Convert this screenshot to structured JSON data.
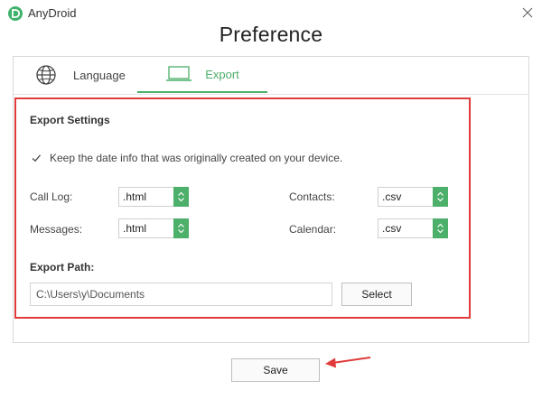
{
  "window": {
    "app_name": "AnyDroid",
    "page_title": "Preference",
    "close_icon": "close-icon"
  },
  "tabs": [
    {
      "label": "Language",
      "icon": "globe-icon",
      "active": false
    },
    {
      "label": "Export",
      "icon": "laptop-icon",
      "active": true
    }
  ],
  "export_settings": {
    "section_title": "Export Settings",
    "keep_date_checkbox": {
      "label": "Keep the date info that was originally created on your device.",
      "checked": true
    },
    "fields": {
      "call_log": {
        "label": "Call Log:",
        "value": ".html"
      },
      "messages": {
        "label": "Messages:",
        "value": ".html"
      },
      "contacts": {
        "label": "Contacts:",
        "value": ".csv"
      },
      "calendar": {
        "label": "Calendar:",
        "value": ".csv"
      }
    },
    "export_path": {
      "section_title": "Export Path:",
      "value": "C:\\Users\\y\\Documents",
      "select_label": "Select"
    }
  },
  "footer": {
    "save_label": "Save"
  },
  "colors": {
    "accent_green": "#4caf6a",
    "highlight_red": "#e03a3a"
  }
}
